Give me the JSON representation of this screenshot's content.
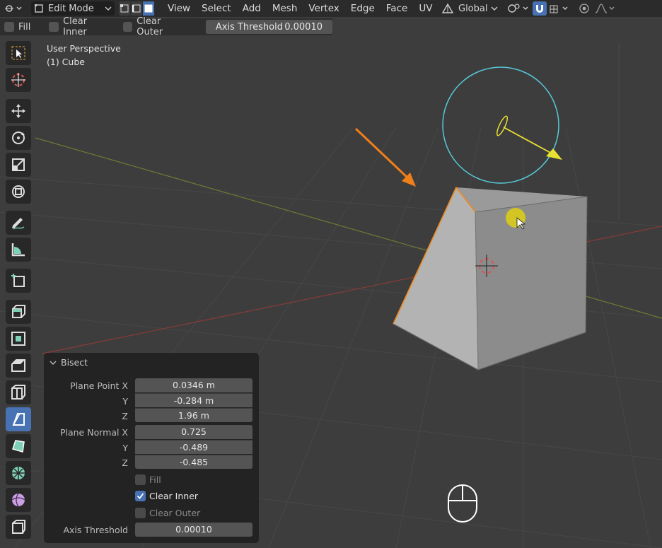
{
  "header": {
    "mode_label": "Edit Mode",
    "menus": [
      "View",
      "Select",
      "Add",
      "Mesh",
      "Vertex",
      "Edge",
      "Face",
      "UV"
    ],
    "orientation_label": "Global"
  },
  "tool_settings": {
    "fill_label": "Fill",
    "clear_inner_label": "Clear Inner",
    "clear_outer_label": "Clear Outer",
    "axis_threshold_label": "Axis Threshold",
    "axis_threshold_value": "0.00010"
  },
  "viewport": {
    "perspective_label": "User Perspective",
    "object_label": "(1) Cube"
  },
  "bisect": {
    "title": "Bisect",
    "plane_point_x_label": "Plane Point X",
    "plane_point_x": "0.0346 m",
    "y_label": "Y",
    "plane_point_y": "-0.284 m",
    "z_label": "Z",
    "plane_point_z": "1.96 m",
    "plane_normal_x_label": "Plane Normal X",
    "plane_normal_x": "0.725",
    "plane_normal_y": "-0.489",
    "plane_normal_z": "-0.485",
    "fill_label": "Fill",
    "fill_checked": false,
    "clear_inner_label": "Clear Inner",
    "clear_inner_checked": true,
    "clear_outer_label": "Clear Outer",
    "clear_outer_checked": false,
    "axis_threshold_label": "Axis Threshold",
    "axis_threshold": "0.00010"
  },
  "colors": {
    "accent": "#4772b3",
    "annotation_arrow": "#f07f1a",
    "gizmo_circle": "#56c8d8",
    "gizmo_arrow": "#e8e032",
    "selected_edge": "#f08a1e"
  }
}
